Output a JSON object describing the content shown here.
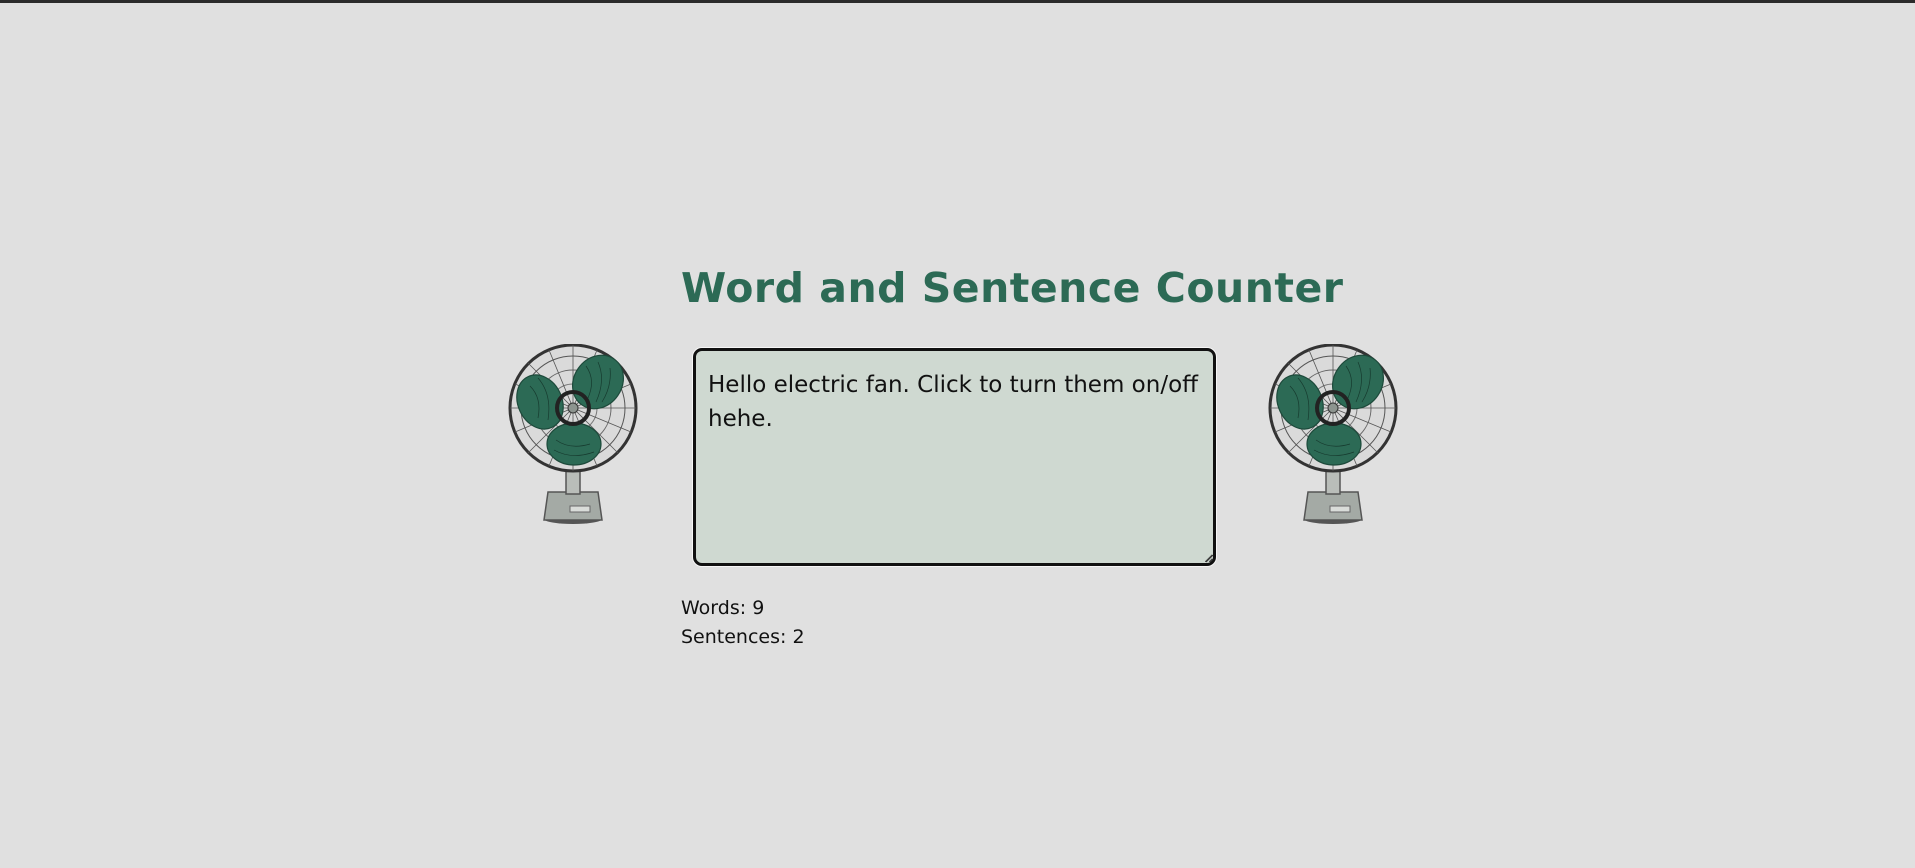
{
  "page": {
    "title": "Word and Sentence Counter"
  },
  "editor": {
    "value": "Hello electric fan. Click to turn them on/off hehe. "
  },
  "stats": {
    "words_label": "Words:",
    "words_value": "9",
    "sentences_label": "Sentences:",
    "sentences_value": "2"
  },
  "fans": {
    "left_icon": "electric-fan-icon",
    "right_icon": "electric-fan-icon",
    "blade_color": "#2c6a55",
    "base_color": "#a4aaa5"
  },
  "colors": {
    "background": "#e0e0e0",
    "title": "#2c6a55",
    "textarea_bg": "#cfd9d1"
  }
}
